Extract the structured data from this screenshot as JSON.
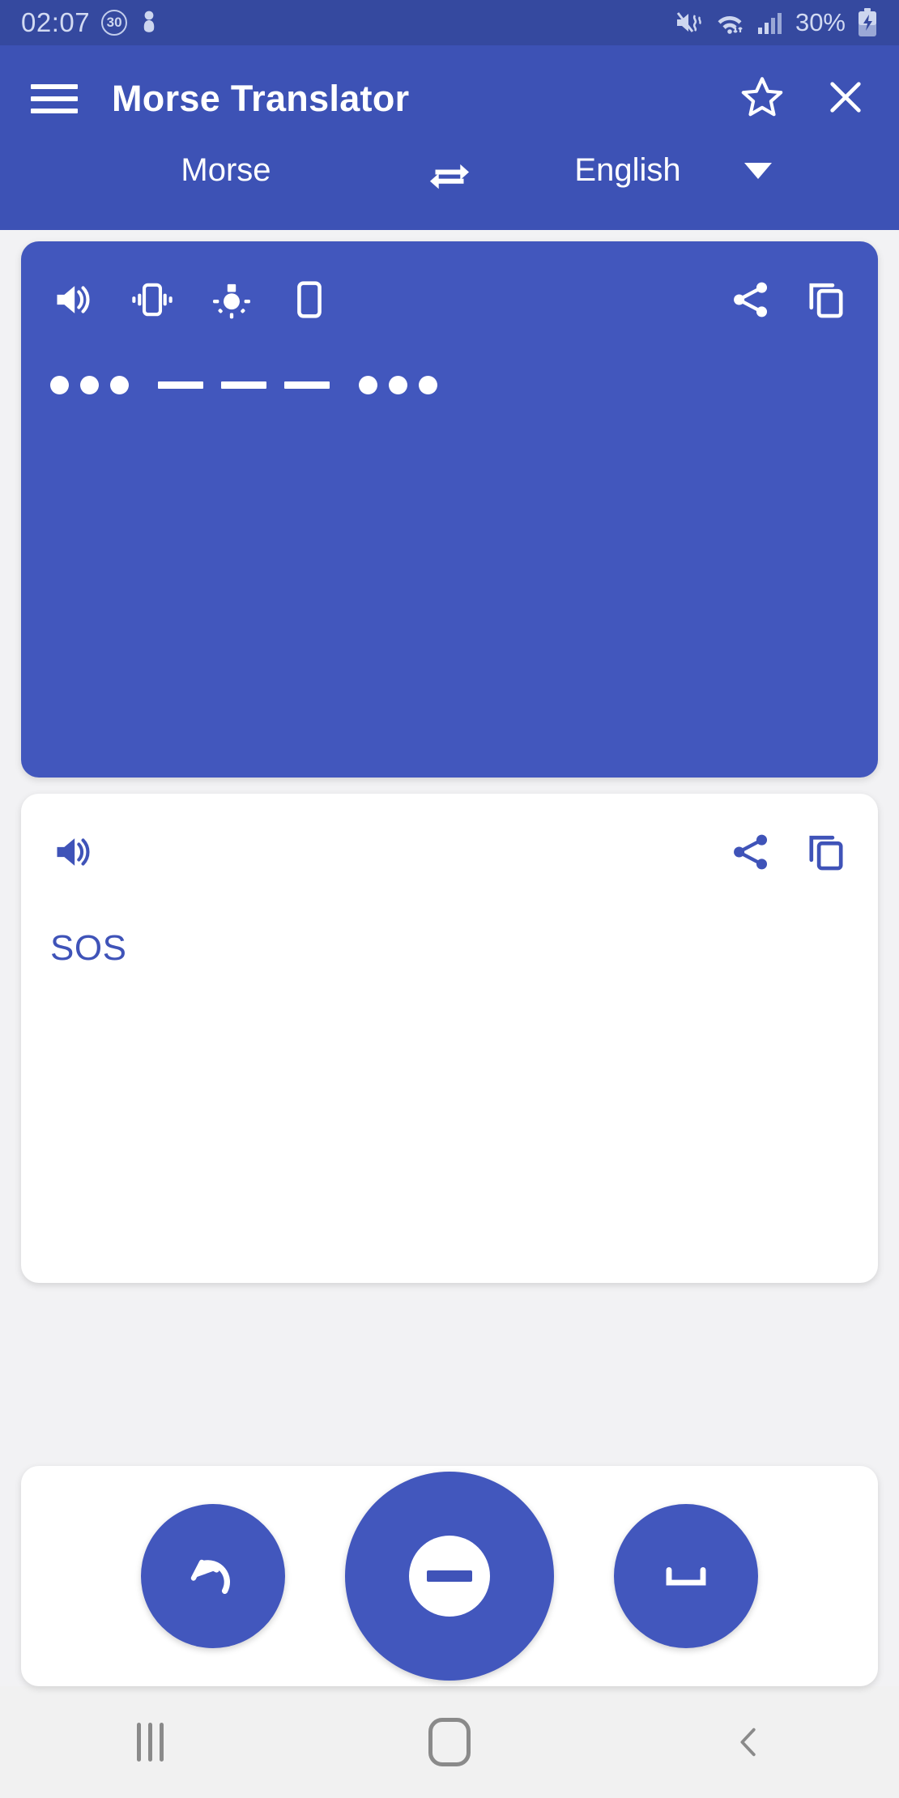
{
  "status_bar": {
    "time": "02:07",
    "timer_badge": "30",
    "battery_percent": "30%",
    "icons": [
      "alarm-30-icon",
      "person-icon",
      "mute-vibrate-icon",
      "wifi-icon",
      "cellular-signal-icon",
      "battery-charging-icon"
    ]
  },
  "app_bar": {
    "title": "Morse Translator",
    "menu_icon": "hamburger-menu-icon",
    "favorite_icon": "star-outline-icon",
    "close_icon": "close-x-icon"
  },
  "language_bar": {
    "source": "Morse",
    "target": "English",
    "swap_icon": "swap-horizontal-icon",
    "dropdown_icon": "chevron-down-icon"
  },
  "input_card": {
    "tools": [
      {
        "name": "sound-icon",
        "label": "Sound"
      },
      {
        "name": "vibrate-icon",
        "label": "Vibrate"
      },
      {
        "name": "flashlight-icon",
        "label": "Flashlight"
      },
      {
        "name": "screen-flash-icon",
        "label": "Screen"
      }
    ],
    "share_icon": "share-icon",
    "copy_icon": "copy-icon",
    "morse_text": "... --- ...",
    "morse_groups": [
      {
        "type": "dots",
        "count": 3
      },
      {
        "type": "dashes",
        "count": 3
      },
      {
        "type": "dots",
        "count": 3
      }
    ]
  },
  "output_card": {
    "sound_icon": "sound-icon",
    "share_icon": "share-icon",
    "copy_icon": "copy-icon",
    "text": "SOS"
  },
  "keypad": {
    "backspace_icon": "backspace-undo-icon",
    "dash_icon": "dash-key-icon",
    "space_icon": "space-bar-icon"
  },
  "nav_bar": {
    "recents_icon": "recents-icon",
    "home_icon": "home-icon",
    "back_icon": "back-chevron-icon"
  },
  "colors": {
    "status_bar": "#35499f",
    "app_bar": "#3d52b5",
    "card_blue": "#4257bd",
    "accent_text": "#3f53b8",
    "page_background": "#f2f2f4"
  }
}
